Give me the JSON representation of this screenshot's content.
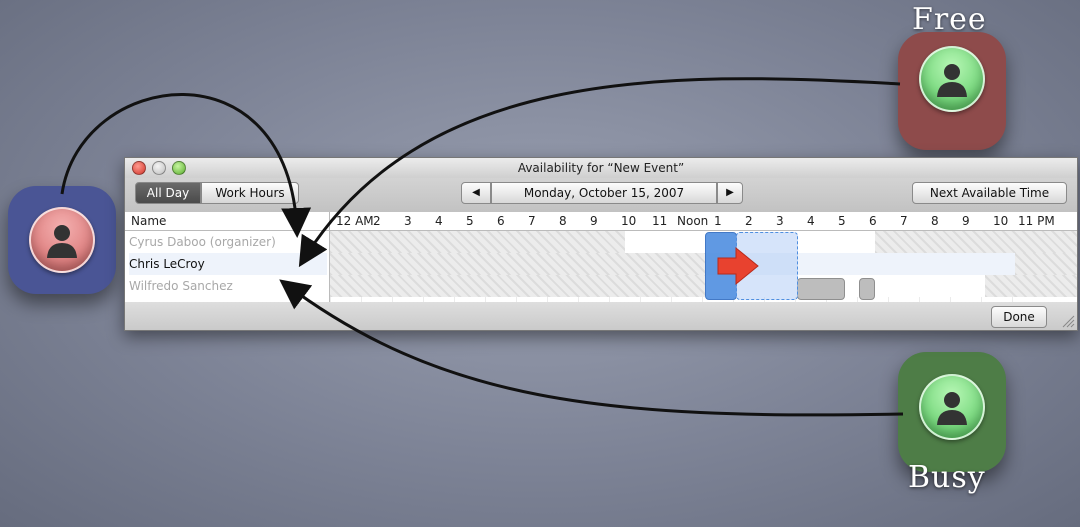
{
  "window": {
    "title": "Availability for “New Event”",
    "segment": {
      "all_day": "All Day",
      "work_hours": "Work Hours"
    },
    "date_label": "Monday, October 15, 2007",
    "prev_label": "◀",
    "next_label": "▶",
    "next_available_label": "Next Available Time",
    "done_label": "Done",
    "name_header": "Name",
    "hours": [
      "12 AM",
      "2",
      "3",
      "4",
      "5",
      "6",
      "7",
      "8",
      "9",
      "10",
      "11",
      "Noon",
      "1",
      "2",
      "3",
      "4",
      "5",
      "6",
      "7",
      "8",
      "9",
      "10",
      "11 PM"
    ],
    "attendees": [
      {
        "name": "Cyrus Daboo (organizer)"
      },
      {
        "name": "Chris LeCroy"
      },
      {
        "name": "Wilfredo Sanchez"
      }
    ]
  },
  "captions": {
    "free": "Free",
    "busy": "Busy"
  },
  "colors": {
    "free_tile": "#8e4b4b",
    "busy_tile": "#4e7d47",
    "attendee_tile": "#4a5595",
    "event_block": "#4f8fe0",
    "arrow": "#e8422f"
  }
}
